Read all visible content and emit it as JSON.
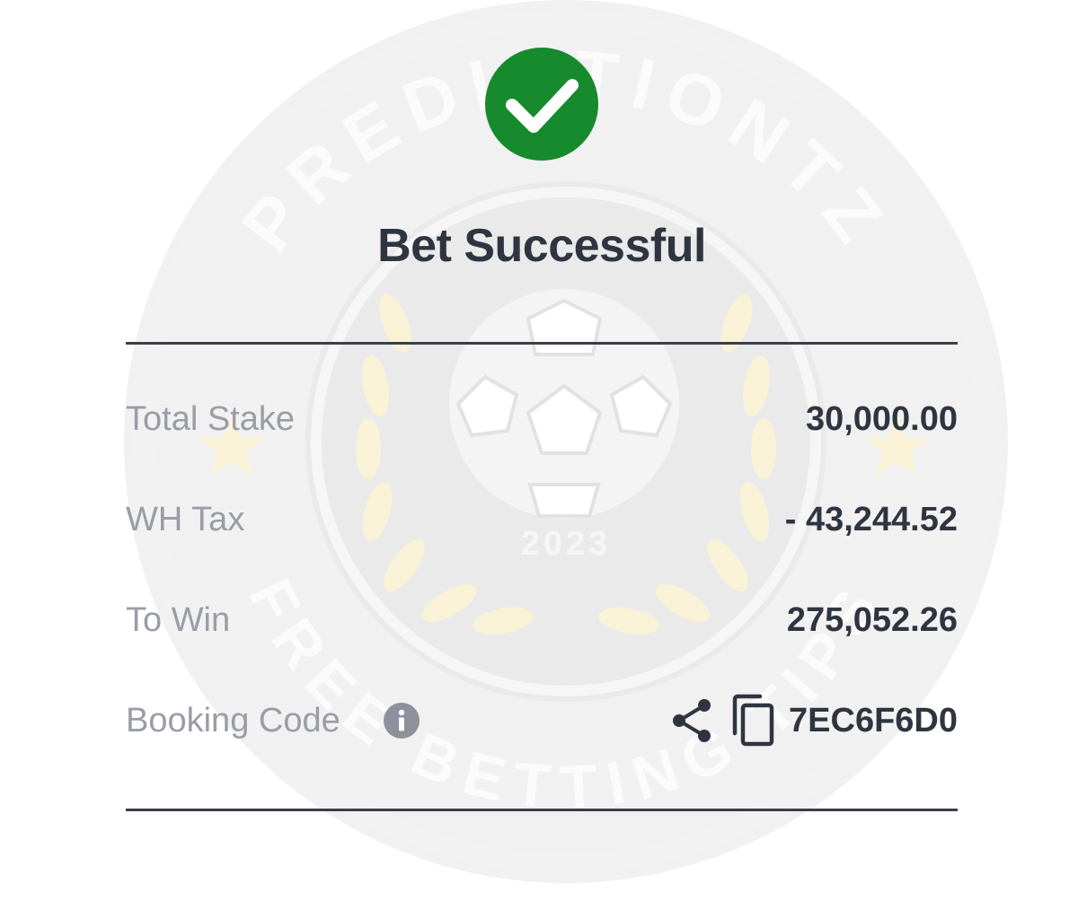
{
  "status": {
    "title": "Bet Successful",
    "icon": "check-circle-icon",
    "icon_color": "#168a2c"
  },
  "summary": {
    "rows": [
      {
        "label": "Total Stake",
        "value": "30,000.00"
      },
      {
        "label": "WH Tax",
        "value": "- 43,244.52"
      },
      {
        "label": "To Win",
        "value": "275,052.26"
      }
    ],
    "booking": {
      "label": "Booking Code",
      "info_icon": "info-icon",
      "share_icon": "share-icon",
      "copy_icon": "copy-icon",
      "code": "7EC6F6D0"
    }
  },
  "watermark": {
    "top_text": "PREDICTIONTZ",
    "bottom_text": "FREE BETTING TIPS",
    "year": "2023"
  },
  "colors": {
    "text_dark": "#2f3540",
    "text_muted": "#9a9ca6",
    "success_green": "#168a2c",
    "divider": "#3a3f4a"
  }
}
